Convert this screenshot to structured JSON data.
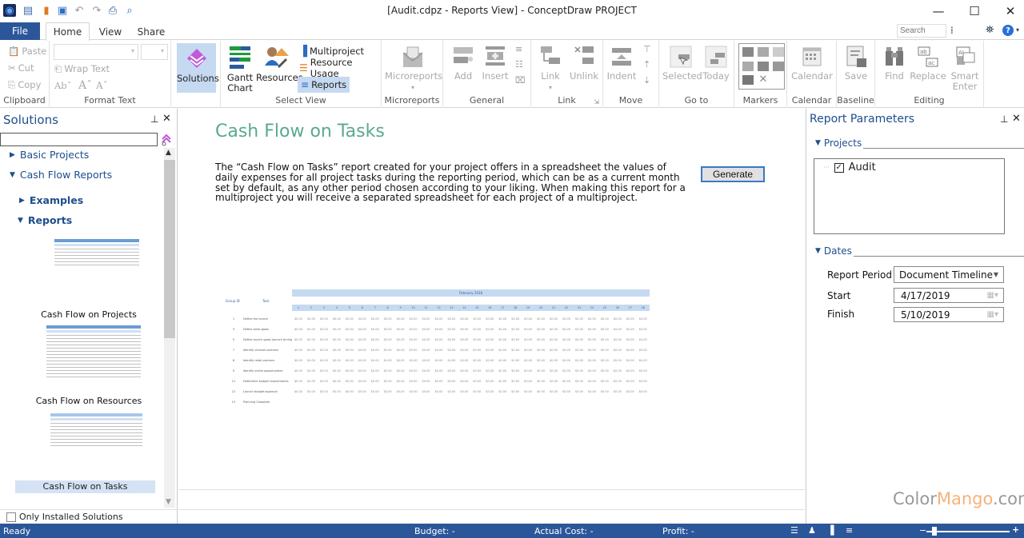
{
  "window": {
    "title": "[Audit.cdpz - Reports View] - ConceptDraw PROJECT",
    "controls": {
      "minimize": "—",
      "maximize": "☐",
      "close": "✕"
    }
  },
  "quick_access": [
    {
      "name": "app-logo-icon",
      "glyph": "◉"
    },
    {
      "name": "new-icon",
      "glyph": "▤"
    },
    {
      "name": "open-icon",
      "glyph": "▮"
    },
    {
      "name": "save-icon",
      "glyph": "▣"
    },
    {
      "name": "undo-icon",
      "glyph": "↶"
    },
    {
      "name": "redo-icon",
      "glyph": "↷"
    },
    {
      "name": "print-icon",
      "glyph": "⎙"
    },
    {
      "name": "print-preview-icon",
      "glyph": "⌕"
    }
  ],
  "tabs": {
    "file": "File",
    "home": "Home",
    "view": "View",
    "share": "Share"
  },
  "search": {
    "placeholder": "Search"
  },
  "ribbon": {
    "clipboard": {
      "label": "Clipboard",
      "paste": "Paste",
      "cut": "Cut",
      "copy": "Copy"
    },
    "format_text": {
      "label": "Format Text",
      "wrap_text": "Wrap Text",
      "ab": "Abˇ",
      "grow": "Aˆ",
      "shrink": "Aˇ"
    },
    "solutions": {
      "label": "Solutions"
    },
    "select_view": {
      "label": "Select View",
      "gantt": "Gantt\nChart",
      "gantt_l1": "Gantt",
      "gantt_l2": "Chart",
      "resources": "Resources",
      "multiproject": "Multiproject",
      "resource_usage": "Resource Usage",
      "reports": "Reports"
    },
    "microreports": {
      "label": "Microreports",
      "button": "Microreports"
    },
    "general": {
      "label": "General",
      "add": "Add",
      "insert": "Insert"
    },
    "link": {
      "label": "Link",
      "link": "Link",
      "unlink": "Unlink"
    },
    "move": {
      "label": "Move",
      "indent": "Indent"
    },
    "goto": {
      "label": "Go to",
      "selected": "Selected",
      "today": "Today"
    },
    "markers": {
      "label": "Markers"
    },
    "calendar": {
      "label": "Calendar",
      "button": "Calendar"
    },
    "baseline": {
      "label": "Baseline",
      "save": "Save"
    },
    "editing": {
      "label": "Editing",
      "find": "Find",
      "replace": "Replace",
      "smart_l1": "Smart",
      "smart_l2": "Enter"
    }
  },
  "solutions_panel": {
    "title": "Solutions",
    "search_value": "",
    "tree": [
      {
        "label": "Basic Projects",
        "expanded": false
      },
      {
        "label": "Cash Flow Reports",
        "expanded": true
      },
      {
        "label": "Examples",
        "expanded": false
      },
      {
        "label": "Reports",
        "expanded": true
      }
    ],
    "thumbnails": [
      {
        "caption": "Cash Flow on Projects"
      },
      {
        "caption": "Cash Flow on Resources"
      },
      {
        "caption": "Cash Flow on Tasks",
        "selected": true
      }
    ],
    "only_installed": {
      "label": "Only Installed Solutions",
      "checked": false
    }
  },
  "report": {
    "title": "Cash Flow on Tasks",
    "description": "The “Cash Flow on Tasks” report created for your project offers in a spreadsheet the values of daily expenses for all project tasks during the reporting period, which can be as a current month set by default, as any other period chosen according to your liking. When making this report for a multiproject you will receive a separated spreadsheet for each project of a multiproject.",
    "generate_label": "Generate",
    "preview": {
      "month": "February 2018",
      "col_headers": [
        "Group ID",
        "Task"
      ],
      "days": [
        "1",
        "2",
        "3",
        "4",
        "5",
        "6",
        "7",
        "8",
        "9",
        "10",
        "11",
        "12",
        "13",
        "14",
        "15",
        "16",
        "17",
        "18",
        "19",
        "20",
        "21",
        "22",
        "23",
        "24",
        "25",
        "26",
        "27",
        "28"
      ],
      "rows": [
        {
          "id": "1",
          "task": "Define the launch"
        },
        {
          "id": "3",
          "task": "Define sales goals"
        },
        {
          "id": "5",
          "task": "Define launch goals (launch timing and publicity objectives)"
        },
        {
          "id": "7",
          "task": "Identify channel partners"
        },
        {
          "id": "8",
          "task": "Identify retail partners"
        },
        {
          "id": "9",
          "task": "Identify online opportunities"
        },
        {
          "id": "11",
          "task": "Determine budget requirements"
        },
        {
          "id": "12",
          "task": "Launch budget approval"
        },
        {
          "id": "13",
          "task": "Planning Complete"
        }
      ],
      "cell_value": "$0.00"
    }
  },
  "params_panel": {
    "title": "Report Parameters",
    "projects_section": "Projects",
    "projects": [
      {
        "label": "Audit",
        "checked": true
      }
    ],
    "dates_section": "Dates",
    "report_period_label": "Report Period",
    "report_period_value": "Document Timeline",
    "start_label": "Start",
    "start_value": "4/17/2019",
    "finish_label": "Finish",
    "finish_value": "5/10/2019"
  },
  "status": {
    "ready": "Ready",
    "budget": "Budget: -",
    "actual_cost": "Actual Cost: -",
    "profit": "Profit: -",
    "zoom_percent": 10
  },
  "watermark": {
    "part1": "Color",
    "part2": "Mango",
    "part3": ".com"
  },
  "colors": {
    "accent": "#2b579a",
    "title_green": "#5aaa8c",
    "link_blue": "#1e4e8c",
    "solutions_purple": "#b24fd8"
  }
}
